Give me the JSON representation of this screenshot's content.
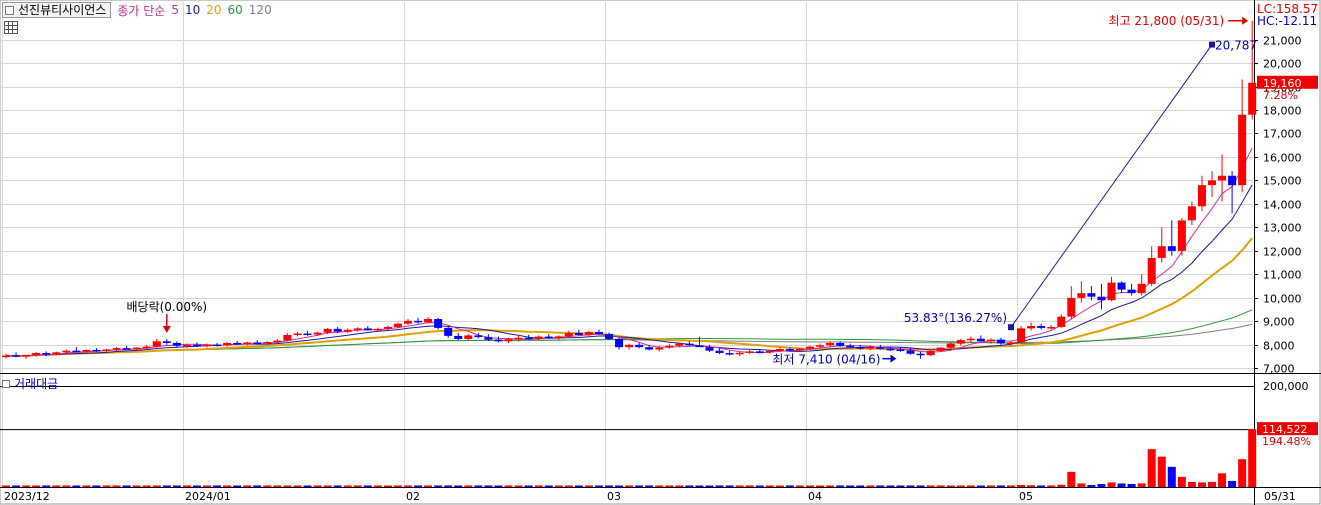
{
  "header": {
    "stock_name": "선진뷰티사이언스",
    "indicator_label": "종가 단순",
    "ma_periods": [
      {
        "label": "5",
        "color": "#d0309a"
      },
      {
        "label": "10",
        "color": "#1a1aa0"
      },
      {
        "label": "20",
        "color": "#e0a000"
      },
      {
        "label": "60",
        "color": "#2a9a3a"
      },
      {
        "label": "120",
        "color": "#808080"
      }
    ]
  },
  "volume_panel": {
    "title": "거래대금"
  },
  "colors": {
    "up": "#ff0000",
    "down": "#0000ff",
    "grid": "#d6d6d6",
    "trend_line": "#1a1aa0",
    "annotation_red": "#e00000",
    "annotation_blue": "#0000c0"
  },
  "chart_data": {
    "type": "candlestick",
    "y_axis": {
      "range": [
        6800,
        22600
      ],
      "ticks": [
        "21,000",
        "20,000",
        "19,000",
        "18,000",
        "17,000",
        "16,000",
        "15,000",
        "14,000",
        "13,000",
        "12,000",
        "11,000",
        "10,000",
        "9,000",
        "8,000",
        "7,000"
      ]
    },
    "volume_axis": {
      "ticks": [
        "200,000"
      ]
    },
    "x_axis": {
      "labels": [
        "2023/12",
        "2024/01",
        "02",
        "03",
        "04",
        "05"
      ],
      "end_label": "05/31"
    },
    "right_labels": {
      "lc": "LC:158.57",
      "hc": "HC:-12.11",
      "last_price": "19,160",
      "last_change": "7.28%",
      "last_volume": "114,522",
      "volume_change": "194.48%"
    },
    "annotations": {
      "high": "최고 21,800 (05/31)",
      "low": "최저 7,410 (04/16)",
      "dividend": "배당락(0.00%)",
      "trend_end": "20,787",
      "trend_start": "53.83°(136.27%)"
    },
    "candles": [
      {
        "o": 7500,
        "h": 7620,
        "l": 7420,
        "c": 7540
      },
      {
        "o": 7560,
        "h": 7680,
        "l": 7470,
        "c": 7500
      },
      {
        "o": 7500,
        "h": 7580,
        "l": 7400,
        "c": 7560
      },
      {
        "o": 7560,
        "h": 7700,
        "l": 7500,
        "c": 7650
      },
      {
        "o": 7650,
        "h": 7720,
        "l": 7520,
        "c": 7600
      },
      {
        "o": 7600,
        "h": 7710,
        "l": 7560,
        "c": 7680
      },
      {
        "o": 7680,
        "h": 7800,
        "l": 7600,
        "c": 7750
      },
      {
        "o": 7750,
        "h": 7900,
        "l": 7700,
        "c": 7720
      },
      {
        "o": 7720,
        "h": 7800,
        "l": 7640,
        "c": 7780
      },
      {
        "o": 7780,
        "h": 7860,
        "l": 7700,
        "c": 7740
      },
      {
        "o": 7740,
        "h": 7830,
        "l": 7690,
        "c": 7800
      },
      {
        "o": 7800,
        "h": 7900,
        "l": 7740,
        "c": 7860
      },
      {
        "o": 7860,
        "h": 7950,
        "l": 7800,
        "c": 7820
      },
      {
        "o": 7820,
        "h": 7900,
        "l": 7760,
        "c": 7880
      },
      {
        "o": 7880,
        "h": 8000,
        "l": 7820,
        "c": 7920
      },
      {
        "o": 7920,
        "h": 8250,
        "l": 7880,
        "c": 8150
      },
      {
        "o": 8150,
        "h": 8250,
        "l": 8000,
        "c": 8080
      },
      {
        "o": 8080,
        "h": 8150,
        "l": 7900,
        "c": 7960
      },
      {
        "o": 7960,
        "h": 8050,
        "l": 7880,
        "c": 8000
      },
      {
        "o": 8000,
        "h": 8100,
        "l": 7900,
        "c": 7950
      },
      {
        "o": 7950,
        "h": 8050,
        "l": 7880,
        "c": 8010
      },
      {
        "o": 8010,
        "h": 8080,
        "l": 7930,
        "c": 7980
      },
      {
        "o": 7980,
        "h": 8120,
        "l": 7930,
        "c": 8080
      },
      {
        "o": 8080,
        "h": 8160,
        "l": 8000,
        "c": 8030
      },
      {
        "o": 8030,
        "h": 8130,
        "l": 7980,
        "c": 8100
      },
      {
        "o": 8100,
        "h": 8200,
        "l": 8040,
        "c": 8060
      },
      {
        "o": 8060,
        "h": 8160,
        "l": 8000,
        "c": 8120
      },
      {
        "o": 8120,
        "h": 8240,
        "l": 8050,
        "c": 8180
      },
      {
        "o": 8180,
        "h": 8500,
        "l": 8150,
        "c": 8420
      },
      {
        "o": 8420,
        "h": 8550,
        "l": 8350,
        "c": 8480
      },
      {
        "o": 8480,
        "h": 8600,
        "l": 8380,
        "c": 8440
      },
      {
        "o": 8440,
        "h": 8560,
        "l": 8380,
        "c": 8520
      },
      {
        "o": 8520,
        "h": 8720,
        "l": 8450,
        "c": 8680
      },
      {
        "o": 8680,
        "h": 8760,
        "l": 8500,
        "c": 8560
      },
      {
        "o": 8560,
        "h": 8700,
        "l": 8500,
        "c": 8640
      },
      {
        "o": 8640,
        "h": 8750,
        "l": 8560,
        "c": 8700
      },
      {
        "o": 8700,
        "h": 8800,
        "l": 8600,
        "c": 8620
      },
      {
        "o": 8620,
        "h": 8730,
        "l": 8560,
        "c": 8680
      },
      {
        "o": 8680,
        "h": 8820,
        "l": 8620,
        "c": 8760
      },
      {
        "o": 8760,
        "h": 8950,
        "l": 8700,
        "c": 8900
      },
      {
        "o": 8900,
        "h": 9100,
        "l": 8850,
        "c": 9020
      },
      {
        "o": 9020,
        "h": 9150,
        "l": 8900,
        "c": 8960
      },
      {
        "o": 8960,
        "h": 9180,
        "l": 8920,
        "c": 9100
      },
      {
        "o": 9100,
        "h": 9150,
        "l": 8650,
        "c": 8720
      },
      {
        "o": 8720,
        "h": 8800,
        "l": 8300,
        "c": 8380
      },
      {
        "o": 8380,
        "h": 8500,
        "l": 8200,
        "c": 8250
      },
      {
        "o": 8250,
        "h": 8450,
        "l": 8200,
        "c": 8400
      },
      {
        "o": 8400,
        "h": 8500,
        "l": 8280,
        "c": 8330
      },
      {
        "o": 8330,
        "h": 8450,
        "l": 8170,
        "c": 8220
      },
      {
        "o": 8220,
        "h": 8350,
        "l": 8100,
        "c": 8150
      },
      {
        "o": 8150,
        "h": 8300,
        "l": 8080,
        "c": 8240
      },
      {
        "o": 8240,
        "h": 8380,
        "l": 8150,
        "c": 8300
      },
      {
        "o": 8300,
        "h": 8420,
        "l": 8220,
        "c": 8260
      },
      {
        "o": 8260,
        "h": 8400,
        "l": 8200,
        "c": 8350
      },
      {
        "o": 8350,
        "h": 8450,
        "l": 8250,
        "c": 8310
      },
      {
        "o": 8310,
        "h": 8400,
        "l": 8220,
        "c": 8360
      },
      {
        "o": 8360,
        "h": 8600,
        "l": 8300,
        "c": 8500
      },
      {
        "o": 8500,
        "h": 8650,
        "l": 8400,
        "c": 8420
      },
      {
        "o": 8420,
        "h": 8600,
        "l": 8380,
        "c": 8550
      },
      {
        "o": 8550,
        "h": 8650,
        "l": 8420,
        "c": 8460
      },
      {
        "o": 8460,
        "h": 8520,
        "l": 8200,
        "c": 8250
      },
      {
        "o": 8250,
        "h": 8300,
        "l": 7800,
        "c": 7900
      },
      {
        "o": 7900,
        "h": 8050,
        "l": 7800,
        "c": 8000
      },
      {
        "o": 8000,
        "h": 8100,
        "l": 7850,
        "c": 7900
      },
      {
        "o": 7900,
        "h": 8000,
        "l": 7760,
        "c": 7800
      },
      {
        "o": 7800,
        "h": 7950,
        "l": 7720,
        "c": 7880
      },
      {
        "o": 7880,
        "h": 8050,
        "l": 7820,
        "c": 7960
      },
      {
        "o": 7960,
        "h": 8100,
        "l": 7900,
        "c": 8050
      },
      {
        "o": 8050,
        "h": 8150,
        "l": 7950,
        "c": 7980
      },
      {
        "o": 7980,
        "h": 8350,
        "l": 7920,
        "c": 7900
      },
      {
        "o": 7900,
        "h": 8000,
        "l": 7700,
        "c": 7750
      },
      {
        "o": 7750,
        "h": 7850,
        "l": 7600,
        "c": 7650
      },
      {
        "o": 7650,
        "h": 7750,
        "l": 7550,
        "c": 7600
      },
      {
        "o": 7600,
        "h": 7700,
        "l": 7520,
        "c": 7660
      },
      {
        "o": 7660,
        "h": 7780,
        "l": 7600,
        "c": 7720
      },
      {
        "o": 7720,
        "h": 7800,
        "l": 7640,
        "c": 7680
      },
      {
        "o": 7680,
        "h": 7790,
        "l": 7620,
        "c": 7740
      },
      {
        "o": 7740,
        "h": 7880,
        "l": 7700,
        "c": 7820
      },
      {
        "o": 7820,
        "h": 7900,
        "l": 7720,
        "c": 7760
      },
      {
        "o": 7760,
        "h": 7880,
        "l": 7700,
        "c": 7840
      },
      {
        "o": 7840,
        "h": 7960,
        "l": 7780,
        "c": 7920
      },
      {
        "o": 7920,
        "h": 8050,
        "l": 7850,
        "c": 7980
      },
      {
        "o": 7980,
        "h": 8150,
        "l": 7920,
        "c": 8080
      },
      {
        "o": 8080,
        "h": 8150,
        "l": 7920,
        "c": 7960
      },
      {
        "o": 7960,
        "h": 8050,
        "l": 7850,
        "c": 7900
      },
      {
        "o": 7900,
        "h": 8000,
        "l": 7800,
        "c": 7860
      },
      {
        "o": 7860,
        "h": 7980,
        "l": 7780,
        "c": 7900
      },
      {
        "o": 7900,
        "h": 8000,
        "l": 7800,
        "c": 7830
      },
      {
        "o": 7830,
        "h": 7920,
        "l": 7740,
        "c": 7800
      },
      {
        "o": 7800,
        "h": 7900,
        "l": 7700,
        "c": 7760
      },
      {
        "o": 7760,
        "h": 7860,
        "l": 7580,
        "c": 7620
      },
      {
        "o": 7620,
        "h": 7700,
        "l": 7410,
        "c": 7560
      },
      {
        "o": 7560,
        "h": 7800,
        "l": 7520,
        "c": 7740
      },
      {
        "o": 7740,
        "h": 7900,
        "l": 7700,
        "c": 7880
      },
      {
        "o": 7880,
        "h": 8120,
        "l": 7820,
        "c": 8050
      },
      {
        "o": 8050,
        "h": 8250,
        "l": 7980,
        "c": 8200
      },
      {
        "o": 8200,
        "h": 8350,
        "l": 8100,
        "c": 8260
      },
      {
        "o": 8260,
        "h": 8400,
        "l": 8120,
        "c": 8150
      },
      {
        "o": 8150,
        "h": 8280,
        "l": 8050,
        "c": 8220
      },
      {
        "o": 8220,
        "h": 8300,
        "l": 8000,
        "c": 8060
      },
      {
        "o": 8060,
        "h": 8150,
        "l": 7950,
        "c": 8100
      },
      {
        "o": 8100,
        "h": 8800,
        "l": 8050,
        "c": 8700
      },
      {
        "o": 8700,
        "h": 8950,
        "l": 8600,
        "c": 8800
      },
      {
        "o": 8800,
        "h": 8900,
        "l": 8650,
        "c": 8720
      },
      {
        "o": 8720,
        "h": 8850,
        "l": 8650,
        "c": 8760
      },
      {
        "o": 8760,
        "h": 9300,
        "l": 8720,
        "c": 9200
      },
      {
        "o": 9200,
        "h": 10500,
        "l": 9100,
        "c": 10000
      },
      {
        "o": 10000,
        "h": 10700,
        "l": 9800,
        "c": 10200
      },
      {
        "o": 10200,
        "h": 10500,
        "l": 9900,
        "c": 10050
      },
      {
        "o": 10050,
        "h": 10600,
        "l": 9500,
        "c": 9900
      },
      {
        "o": 9900,
        "h": 10900,
        "l": 9850,
        "c": 10650
      },
      {
        "o": 10650,
        "h": 10700,
        "l": 10200,
        "c": 10350
      },
      {
        "o": 10350,
        "h": 10600,
        "l": 10100,
        "c": 10200
      },
      {
        "o": 10200,
        "h": 11000,
        "l": 10100,
        "c": 10600
      },
      {
        "o": 10600,
        "h": 12200,
        "l": 10500,
        "c": 11700
      },
      {
        "o": 11700,
        "h": 13000,
        "l": 11500,
        "c": 12200
      },
      {
        "o": 12200,
        "h": 13300,
        "l": 11800,
        "c": 12000
      },
      {
        "o": 12000,
        "h": 13400,
        "l": 11800,
        "c": 13300
      },
      {
        "o": 13300,
        "h": 14100,
        "l": 13100,
        "c": 13900
      },
      {
        "o": 13900,
        "h": 15200,
        "l": 13700,
        "c": 14800
      },
      {
        "o": 14800,
        "h": 15400,
        "l": 14300,
        "c": 15000
      },
      {
        "o": 15000,
        "h": 16100,
        "l": 14100,
        "c": 15200
      },
      {
        "o": 15200,
        "h": 15400,
        "l": 13600,
        "c": 14800
      },
      {
        "o": 14800,
        "h": 19300,
        "l": 14500,
        "c": 17800
      },
      {
        "o": 17800,
        "h": 21800,
        "l": 17600,
        "c": 19160
      }
    ],
    "volume": [
      {
        "v": 1200
      },
      {
        "v": 1100
      },
      {
        "v": 900
      },
      {
        "v": 1000
      },
      {
        "v": 950
      },
      {
        "v": 1000
      },
      {
        "v": 1100
      },
      {
        "v": 1000
      },
      {
        "v": 900
      },
      {
        "v": 950
      },
      {
        "v": 900
      },
      {
        "v": 1000
      },
      {
        "v": 900
      },
      {
        "v": 950
      },
      {
        "v": 1000
      },
      {
        "v": 1500
      },
      {
        "v": 1300
      },
      {
        "v": 1100
      },
      {
        "v": 1000
      },
      {
        "v": 950
      },
      {
        "v": 900
      },
      {
        "v": 900
      },
      {
        "v": 1000
      },
      {
        "v": 900
      },
      {
        "v": 950
      },
      {
        "v": 900
      },
      {
        "v": 950
      },
      {
        "v": 1000
      },
      {
        "v": 1500
      },
      {
        "v": 1300
      },
      {
        "v": 1200
      },
      {
        "v": 1100
      },
      {
        "v": 1400
      },
      {
        "v": 1300
      },
      {
        "v": 1200
      },
      {
        "v": 1100
      },
      {
        "v": 1000
      },
      {
        "v": 1000
      },
      {
        "v": 1100
      },
      {
        "v": 1300
      },
      {
        "v": 1500
      },
      {
        "v": 1300
      },
      {
        "v": 1400
      },
      {
        "v": 1600
      },
      {
        "v": 1500
      },
      {
        "v": 1300
      },
      {
        "v": 1200
      },
      {
        "v": 1100
      },
      {
        "v": 1100
      },
      {
        "v": 1000
      },
      {
        "v": 1000
      },
      {
        "v": 1100
      },
      {
        "v": 1000
      },
      {
        "v": 1000
      },
      {
        "v": 1000
      },
      {
        "v": 1000
      },
      {
        "v": 1200
      },
      {
        "v": 1100
      },
      {
        "v": 1100
      },
      {
        "v": 1000
      },
      {
        "v": 1100
      },
      {
        "v": 1200
      },
      {
        "v": 1000
      },
      {
        "v": 900
      },
      {
        "v": 900
      },
      {
        "v": 950
      },
      {
        "v": 950
      },
      {
        "v": 1000
      },
      {
        "v": 900
      },
      {
        "v": 1100
      },
      {
        "v": 1000
      },
      {
        "v": 900
      },
      {
        "v": 850
      },
      {
        "v": 850
      },
      {
        "v": 900
      },
      {
        "v": 850
      },
      {
        "v": 900
      },
      {
        "v": 950
      },
      {
        "v": 900
      },
      {
        "v": 900
      },
      {
        "v": 950
      },
      {
        "v": 950
      },
      {
        "v": 1100
      },
      {
        "v": 1000
      },
      {
        "v": 900
      },
      {
        "v": 900
      },
      {
        "v": 900
      },
      {
        "v": 850
      },
      {
        "v": 850
      },
      {
        "v": 850
      },
      {
        "v": 1000
      },
      {
        "v": 1100
      },
      {
        "v": 1000
      },
      {
        "v": 1200
      },
      {
        "v": 1400
      },
      {
        "v": 1500
      },
      {
        "v": 1300
      },
      {
        "v": 1100
      },
      {
        "v": 1000
      },
      {
        "v": 900
      },
      {
        "v": 900
      },
      {
        "v": 4000
      },
      {
        "v": 3500
      },
      {
        "v": 2500
      },
      {
        "v": 2000
      },
      {
        "v": 4500
      },
      {
        "v": 30000
      },
      {
        "v": 7000
      },
      {
        "v": 4000
      },
      {
        "v": 6000
      },
      {
        "v": 9000
      },
      {
        "v": 7000
      },
      {
        "v": 6000
      },
      {
        "v": 7000
      },
      {
        "v": 75000
      },
      {
        "v": 60000
      },
      {
        "v": 40000
      },
      {
        "v": 20000
      },
      {
        "v": 10000
      },
      {
        "v": 9000
      },
      {
        "v": 10000
      },
      {
        "v": 27000
      },
      {
        "v": 12000
      },
      {
        "v": 55000
      },
      {
        "v": 114522
      }
    ]
  }
}
